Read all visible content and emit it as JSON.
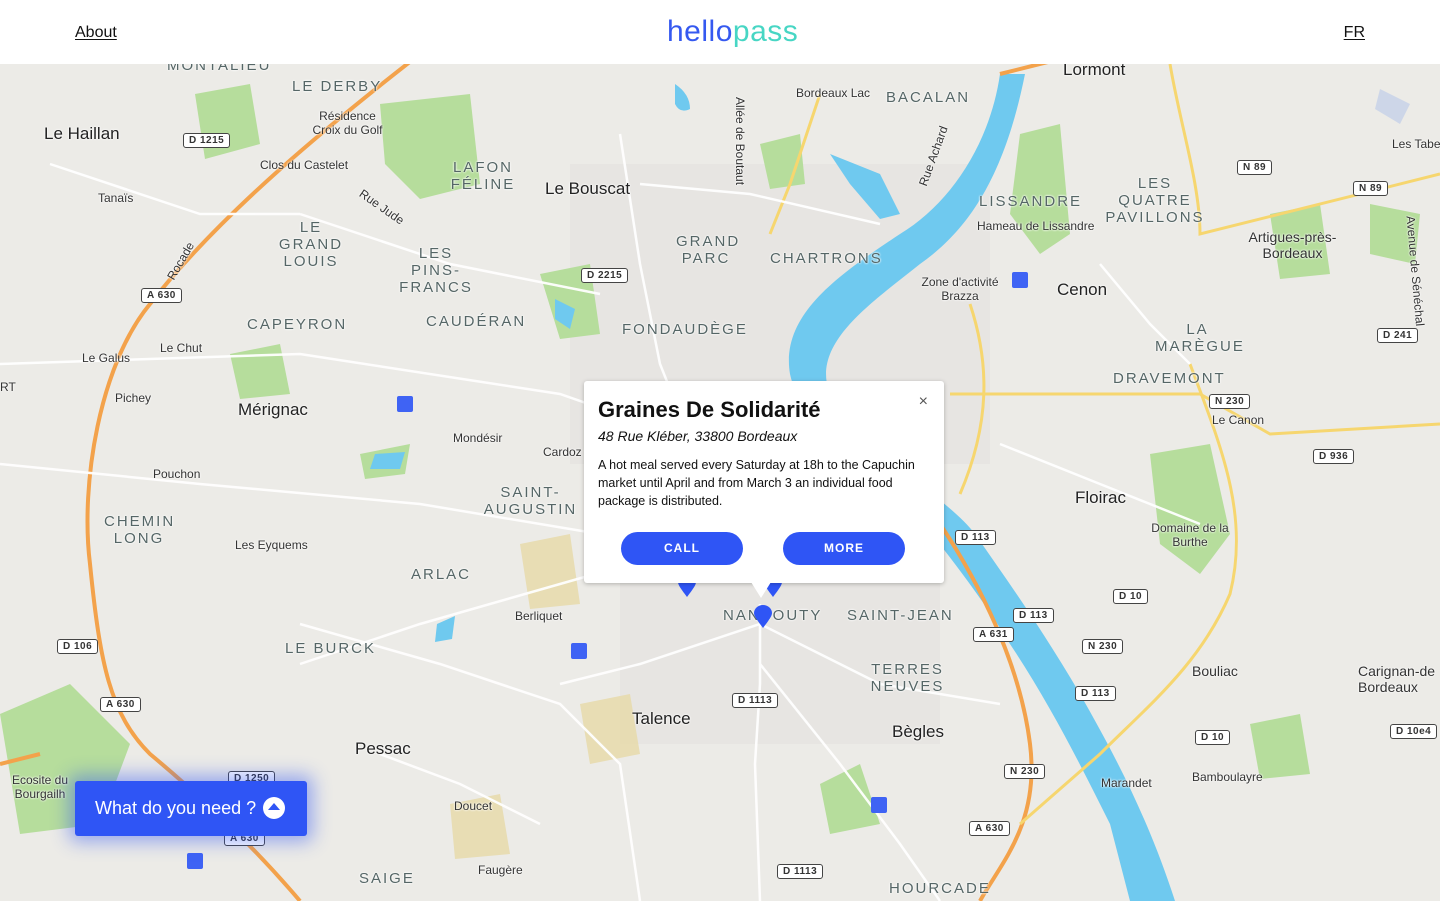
{
  "header": {
    "about": "About",
    "logo_part1": "hello",
    "logo_part2": "pass",
    "lang": "FR"
  },
  "popup": {
    "title": "Graines De Solidarité",
    "address": "48 Rue Kléber, 33800 Bordeaux",
    "description": "A hot meal served every Saturday at 18h to the Capuchin market until April and from March 3 an individual food package is distributed.",
    "close": "×",
    "call": "CALL",
    "more": "MORE"
  },
  "need_button": {
    "label": "What do you need ?"
  },
  "map": {
    "towns": [
      "Le Haillan",
      "Le Bouscat",
      "Mérignac",
      "Cenon",
      "Floirac",
      "Talence",
      "Pessac",
      "Bègles",
      "Lormont"
    ],
    "districts": [
      "LE DERBY",
      "LAFON FÉLINE",
      "LE GRAND LOUIS",
      "LES PINS-FRANCS",
      "GRAND PARC",
      "CHARTRONS",
      "CAPEYRON",
      "CAUDÉRAN",
      "FONDAUDÈGE",
      "BACALAN",
      "LISSANDRE",
      "LES QUATRE PAVILLONS",
      "LA MARÈGUE",
      "DRAVEMONT",
      "SAINT-AUGUSTIN",
      "CHEMIN LONG",
      "ARLAC",
      "LE BURCK",
      "NANSOUTY",
      "SAINT-JEAN",
      "TERRES NEUVES",
      "SAIGE",
      "HOURCADE",
      "MONTALIEU"
    ],
    "places": [
      "Résidence Croix du Golf",
      "Clos du Castelet",
      "Tanaïs",
      "Rue Jude",
      "Bordeaux Lac",
      "Allée de Boutaut",
      "Rue Achard",
      "Hameau de Lissandre",
      "Zone d'activité Brazza",
      "Les Tabe",
      "Artigues-près-Bordeaux",
      "Avenue de Sénéchal",
      "Le Galus",
      "Le Chut",
      "Pichey",
      "Mondésir",
      "Cardoz",
      "Pouchon",
      "Les Eyquems",
      "Berliquet",
      "Le Canon",
      "Domaine de la Burthe",
      "Bouliac",
      "Carignan-de Bordeaux",
      "Ecosite du Bourgailh",
      "Doucet",
      "Faugère",
      "Marandet",
      "Bamboulayre",
      "Rocade",
      "RT"
    ],
    "roads": [
      "D 1215",
      "A 630",
      "D 2215",
      "N 89",
      "N 89",
      "D 241",
      "N 230",
      "D 936",
      "D 113",
      "D 113",
      "D 10",
      "A 631",
      "N 230",
      "D 113",
      "D 1113",
      "D 106",
      "A 630",
      "D 1250",
      "A 630",
      "D 10",
      "D 10e4",
      "N 230",
      "A 630",
      "D 1113"
    ]
  },
  "colors": {
    "accent": "#2f55f5",
    "logo_teal": "#47d6c4",
    "water": "#6fc9ef",
    "park": "#a6d98a",
    "motorway": "#f3a24b"
  }
}
